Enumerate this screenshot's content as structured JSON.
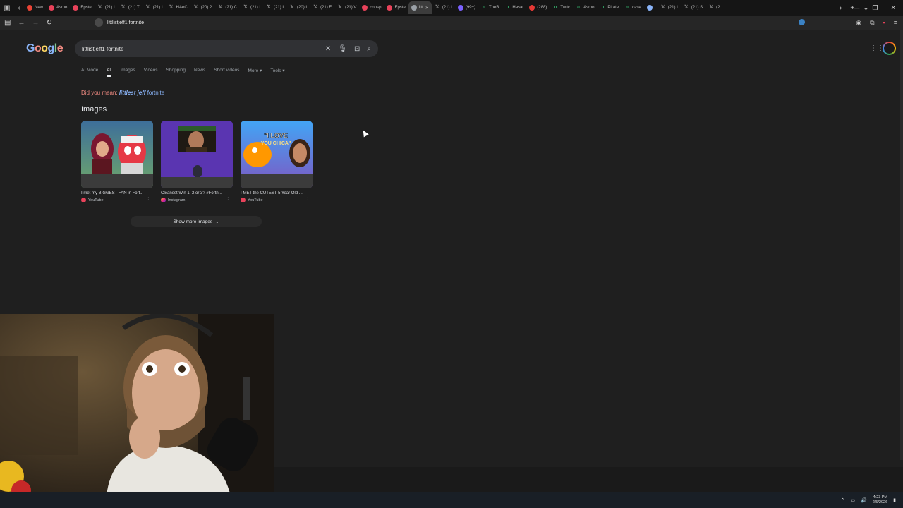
{
  "browser": {
    "tabs": [
      {
        "label": "New",
        "color": "#ea4335"
      },
      {
        "label": "Asmo",
        "color": "#e8425a"
      },
      {
        "label": "Epste",
        "color": "#e8425a"
      },
      {
        "label": "(21) I",
        "icon": "x"
      },
      {
        "label": "(21) T",
        "icon": "x"
      },
      {
        "label": "(21) I",
        "icon": "x"
      },
      {
        "label": "HAeC",
        "icon": "x"
      },
      {
        "label": "(20) 2",
        "icon": "x"
      },
      {
        "label": "(21) C",
        "icon": "x"
      },
      {
        "label": "(21) I",
        "icon": "x"
      },
      {
        "label": "(21) I",
        "icon": "x"
      },
      {
        "label": "(20) I",
        "icon": "x"
      },
      {
        "label": "(21) F",
        "icon": "x"
      },
      {
        "label": "(21) V",
        "icon": "x"
      },
      {
        "label": "consp",
        "color": "#e8425a"
      },
      {
        "label": "Epste",
        "color": "#e8425a"
      },
      {
        "label": "litt",
        "color": "#9aa0a6",
        "active": true
      },
      {
        "label": "(21) I",
        "icon": "x"
      },
      {
        "label": "(99+)",
        "color": "#7b61ff"
      },
      {
        "label": "TheB",
        "icon": "tt"
      },
      {
        "label": "Hasar",
        "icon": "tt"
      },
      {
        "label": "(288)",
        "color": "#e53935"
      },
      {
        "label": "Twitc",
        "icon": "tt"
      },
      {
        "label": "Asmo",
        "icon": "tt"
      },
      {
        "label": "Pirate",
        "icon": "tt"
      },
      {
        "label": "case",
        "icon": "tt"
      },
      {
        "label": "",
        "color": "#8ab4f8"
      },
      {
        "label": "(21) I",
        "icon": "x"
      },
      {
        "label": "(21) S",
        "icon": "x"
      },
      {
        "label": "(2",
        "icon": "x"
      }
    ],
    "address": "littlistjeff1 fortnite"
  },
  "google": {
    "query": "littlistjeff1 fortnite",
    "filters": [
      "AI Mode",
      "All",
      "Images",
      "Videos",
      "Shopping",
      "News",
      "Short videos",
      "More",
      "Tools"
    ],
    "did_you_mean_label": "Did you mean:",
    "suggestion_bold": "littlest jeff",
    "suggestion_rest": "fortnite",
    "images_heading": "Images",
    "images": [
      {
        "caption": "I met my BIGGEST FAN in Fort...",
        "source": "YouTube"
      },
      {
        "caption": "Cleanest Win 1, 2 or 3? #Fortn...",
        "source": "Instagram"
      },
      {
        "caption": "I MET the CUTEST 5 Year Old ...",
        "source": "YouTube",
        "overlay": "I LOVE YOU CHICA"
      }
    ],
    "show_more": "Show more images"
  },
  "taskbar": {
    "time": "4:23 PM",
    "date": "2/5/2026"
  }
}
